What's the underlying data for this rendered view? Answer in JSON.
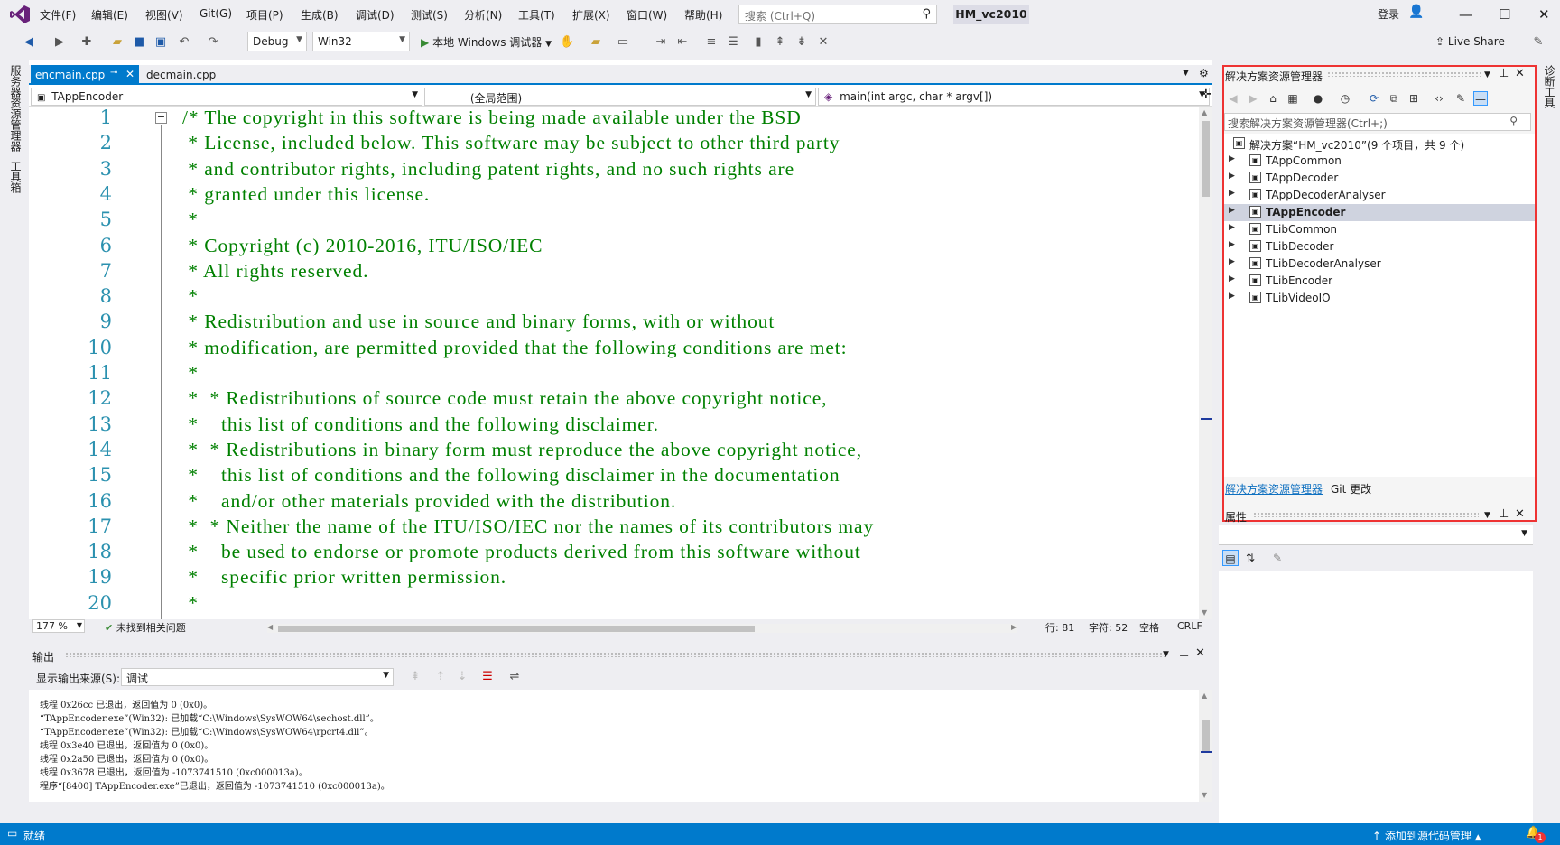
{
  "menubar": {
    "items": [
      "文件(F)",
      "编辑(E)",
      "视图(V)",
      "Git(G)",
      "项目(P)",
      "生成(B)",
      "调试(D)",
      "测试(S)",
      "分析(N)",
      "工具(T)",
      "扩展(X)",
      "窗口(W)",
      "帮助(H)"
    ],
    "search_placeholder": "搜索 (Ctrl+Q)",
    "project_title": "HM_vc2010",
    "login": "登录"
  },
  "toolbar": {
    "config": "Debug",
    "platform": "Win32",
    "run_label": "本地 Windows 调试器",
    "live_share": "Live Share"
  },
  "left_strip": {
    "server_explorer": "服务器资源管理器",
    "toolbox": "工具箱"
  },
  "right_strip": {
    "diagnostics": "诊断工具"
  },
  "editor": {
    "tabs": [
      {
        "label": "encmain.cpp",
        "active": true
      },
      {
        "label": "decmain.cpp",
        "active": false
      }
    ],
    "nav": {
      "project": "TAppEncoder",
      "scope": "(全局范围)",
      "member": "main(int argc, char * argv[])"
    },
    "lines": [
      {
        "n": "1",
        "text": "/* The copyright in this software is being made available under the BSD"
      },
      {
        "n": "2",
        "text": " * License, included below. This software may be subject to other third party"
      },
      {
        "n": "3",
        "text": " * and contributor rights, including patent rights, and no such rights are"
      },
      {
        "n": "4",
        "text": " * granted under this license."
      },
      {
        "n": "5",
        "text": " *"
      },
      {
        "n": "6",
        "text": " * Copyright (c) 2010-2016, ITU/ISO/IEC"
      },
      {
        "n": "7",
        "text": " * All rights reserved."
      },
      {
        "n": "8",
        "text": " *"
      },
      {
        "n": "9",
        "text": " * Redistribution and use in source and binary forms, with or without"
      },
      {
        "n": "10",
        "text": " * modification, are permitted provided that the following conditions are met:"
      },
      {
        "n": "11",
        "text": " *"
      },
      {
        "n": "12",
        "text": " *  * Redistributions of source code must retain the above copyright notice,"
      },
      {
        "n": "13",
        "text": " *    this list of conditions and the following disclaimer."
      },
      {
        "n": "14",
        "text": " *  * Redistributions in binary form must reproduce the above copyright notice,"
      },
      {
        "n": "15",
        "text": " *    this list of conditions and the following disclaimer in the documentation"
      },
      {
        "n": "16",
        "text": " *    and/or other materials provided with the distribution."
      },
      {
        "n": "17",
        "text": " *  * Neither the name of the ITU/ISO/IEC nor the names of its contributors may"
      },
      {
        "n": "18",
        "text": " *    be used to endorse or promote products derived from this software without"
      },
      {
        "n": "19",
        "text": " *    specific prior written permission."
      },
      {
        "n": "20",
        "text": " *"
      }
    ],
    "status": {
      "zoom": "177 %",
      "issues": "未找到相关问题",
      "line": "行: 81",
      "char": "字符: 52",
      "spaces": "空格",
      "eol": "CRLF"
    }
  },
  "output": {
    "title": "输出",
    "source_label": "显示输出来源(S):",
    "source_value": "调试",
    "lines": [
      "线程 0x26cc 已退出，返回值为 0 (0x0)。",
      "“TAppEncoder.exe”(Win32): 已加载“C:\\Windows\\SysWOW64\\sechost.dll”。",
      "“TAppEncoder.exe”(Win32): 已加载“C:\\Windows\\SysWOW64\\rpcrt4.dll”。",
      "线程 0x3e40 已退出，返回值为 0 (0x0)。",
      "线程 0x2a50 已退出，返回值为 0 (0x0)。",
      "线程 0x3678 已退出，返回值为 -1073741510 (0xc000013a)。",
      "程序“[8400] TAppEncoder.exe”已退出，返回值为 -1073741510 (0xc000013a)。"
    ]
  },
  "solution_explorer": {
    "title": "解决方案资源管理器",
    "search_placeholder": "搜索解决方案资源管理器(Ctrl+;)",
    "root": "解决方案“HM_vc2010”(9 个项目，共 9 个)",
    "projects": [
      {
        "name": "TAppCommon",
        "selected": false
      },
      {
        "name": "TAppDecoder",
        "selected": false
      },
      {
        "name": "TAppDecoderAnalyser",
        "selected": false
      },
      {
        "name": "TAppEncoder",
        "selected": true
      },
      {
        "name": "TLibCommon",
        "selected": false
      },
      {
        "name": "TLibDecoder",
        "selected": false
      },
      {
        "name": "TLibDecoderAnalyser",
        "selected": false
      },
      {
        "name": "TLibEncoder",
        "selected": false
      },
      {
        "name": "TLibVideoIO",
        "selected": false
      }
    ],
    "tab_solution": "解决方案资源管理器",
    "tab_git": "Git 更改"
  },
  "properties": {
    "title": "属性"
  },
  "statusbar": {
    "ready": "就绪",
    "source_control": "添加到源代码管理",
    "notification_count": "1"
  },
  "colors": {
    "accent": "#007acc",
    "highlight_border": "#e33333",
    "comment_green": "#008000",
    "line_number": "#2b91af"
  }
}
